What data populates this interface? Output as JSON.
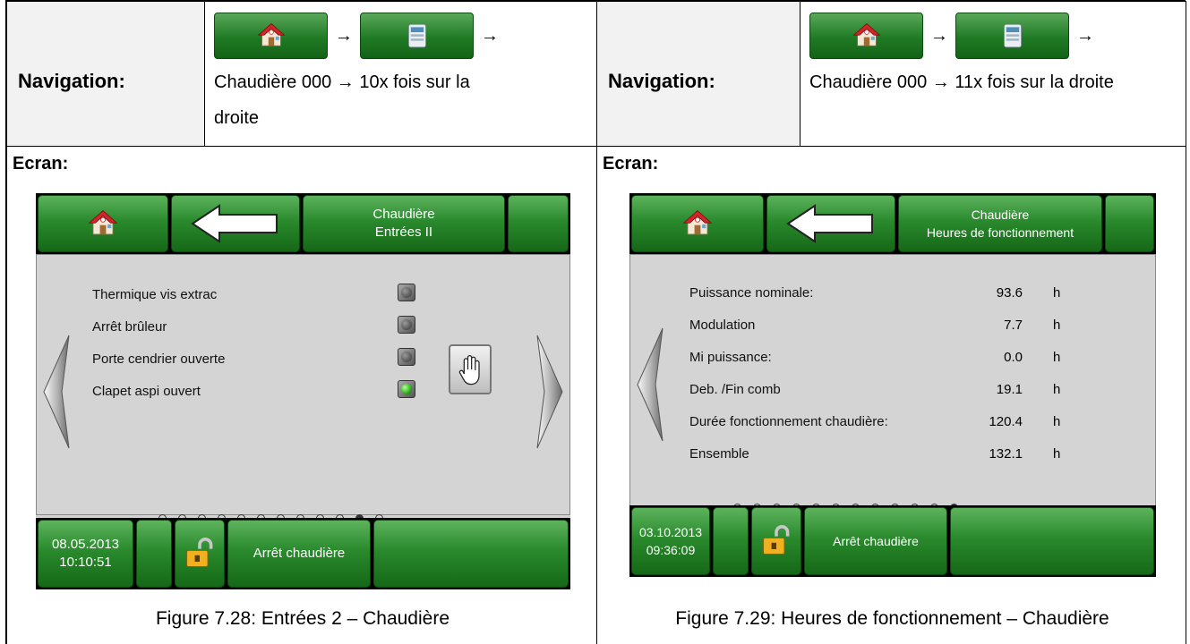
{
  "left": {
    "nav_label": "Navigation:",
    "nav_text_line1_suffix": "→",
    "nav_text": "Chaudière 000 → 10x fois sur la",
    "nav_text2": "droite",
    "ecran_label": "Ecran:",
    "screen": {
      "title_line1": "Chaudière",
      "title_line2": "Entrées II",
      "rows": [
        {
          "label": "Thermique vis extrac",
          "state": "off"
        },
        {
          "label": "Arrêt brûleur",
          "state": "off"
        },
        {
          "label": "Porte cendrier ouverte",
          "state": "off"
        },
        {
          "label": "Clapet aspi ouvert",
          "state": "on"
        }
      ],
      "dots_count": 12,
      "dots_active": 10,
      "date": "08.05.2013",
      "time": "10:10:51",
      "status": "Arrêt chaudière"
    },
    "caption": "Figure 7.28: Entrées 2 – Chaudière"
  },
  "right": {
    "nav_label": "Navigation:",
    "nav_text": "Chaudière 000 → 11x fois sur la droite",
    "ecran_label": "Ecran:",
    "screen": {
      "title_line1": "Chaudière",
      "title_line2": "Heures de fonctionnement",
      "rows": [
        {
          "label": "Puissance nominale:",
          "value": "93.6",
          "unit": "h"
        },
        {
          "label": "Modulation",
          "value": "7.7",
          "unit": "h"
        },
        {
          "label": "Mi puissance:",
          "value": "0.0",
          "unit": "h"
        },
        {
          "label": "Deb. /Fin comb",
          "value": "19.1",
          "unit": "h"
        },
        {
          "label": "Durée fonctionnement chaudière:",
          "value": "120.4",
          "unit": "h"
        },
        {
          "label": "Ensemble",
          "value": "132.1",
          "unit": "h"
        }
      ],
      "dots_count": 12,
      "dots_active": 11,
      "date": "03.10.2013",
      "time": "09:36:09",
      "status": "Arrêt chaudière"
    },
    "caption": "Figure 7.29: Heures de fonctionnement – Chaudière"
  },
  "arrow": "→",
  "icons": [
    "home-icon",
    "display-icon",
    "back-arrow-icon",
    "unlock-icon",
    "hand-icon",
    "chevron-left-icon",
    "chevron-right-icon"
  ]
}
